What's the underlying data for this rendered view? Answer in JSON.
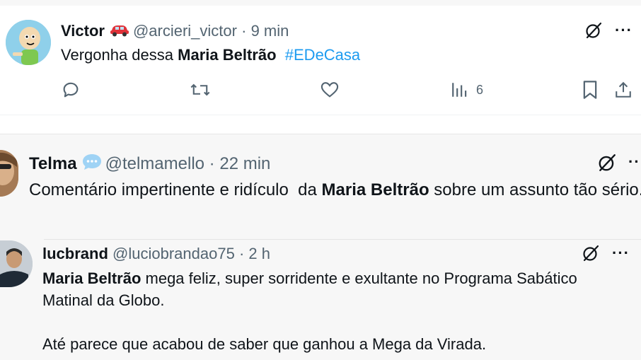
{
  "tweet1": {
    "name": "Victor",
    "name_emoji": "red-car-emoji",
    "handle": "@arcieri_victor",
    "separator": "·",
    "time": "9 min",
    "text_prefix": "Vergonha dessa ",
    "text_bold": "Maria Beltrão",
    "text_gap": "  ",
    "hashtag": "#EDeCasa",
    "more": "···",
    "views_count": "6"
  },
  "tweet2": {
    "name": "Telma",
    "name_emoji": "speech-bubble-emoji",
    "handle": "@telmamello",
    "separator": "·",
    "time": "22 min",
    "text_prefix": "Comentário impertinente e ridículo  da ",
    "text_bold": "Maria Beltrão",
    "text_suffix": " sobre um assunto tão sério.",
    "more": "···"
  },
  "tweet3": {
    "name": "lucbrand",
    "handle": "@luciobrandao75",
    "separator": "·",
    "time": "2 h",
    "text_bold": "Maria Beltrão",
    "text_line1_suffix": " mega feliz, super sorridente e exultante no Programa Sabático Matinal da Globo.",
    "text_line2": "Até parece que acabou de saber que ganhou a Mega da Virada.",
    "more": "···"
  },
  "colors": {
    "text_primary": "#0f1419",
    "text_secondary": "#536471",
    "link": "#1d9bf0",
    "thread_bg": "#f7f7f7"
  }
}
